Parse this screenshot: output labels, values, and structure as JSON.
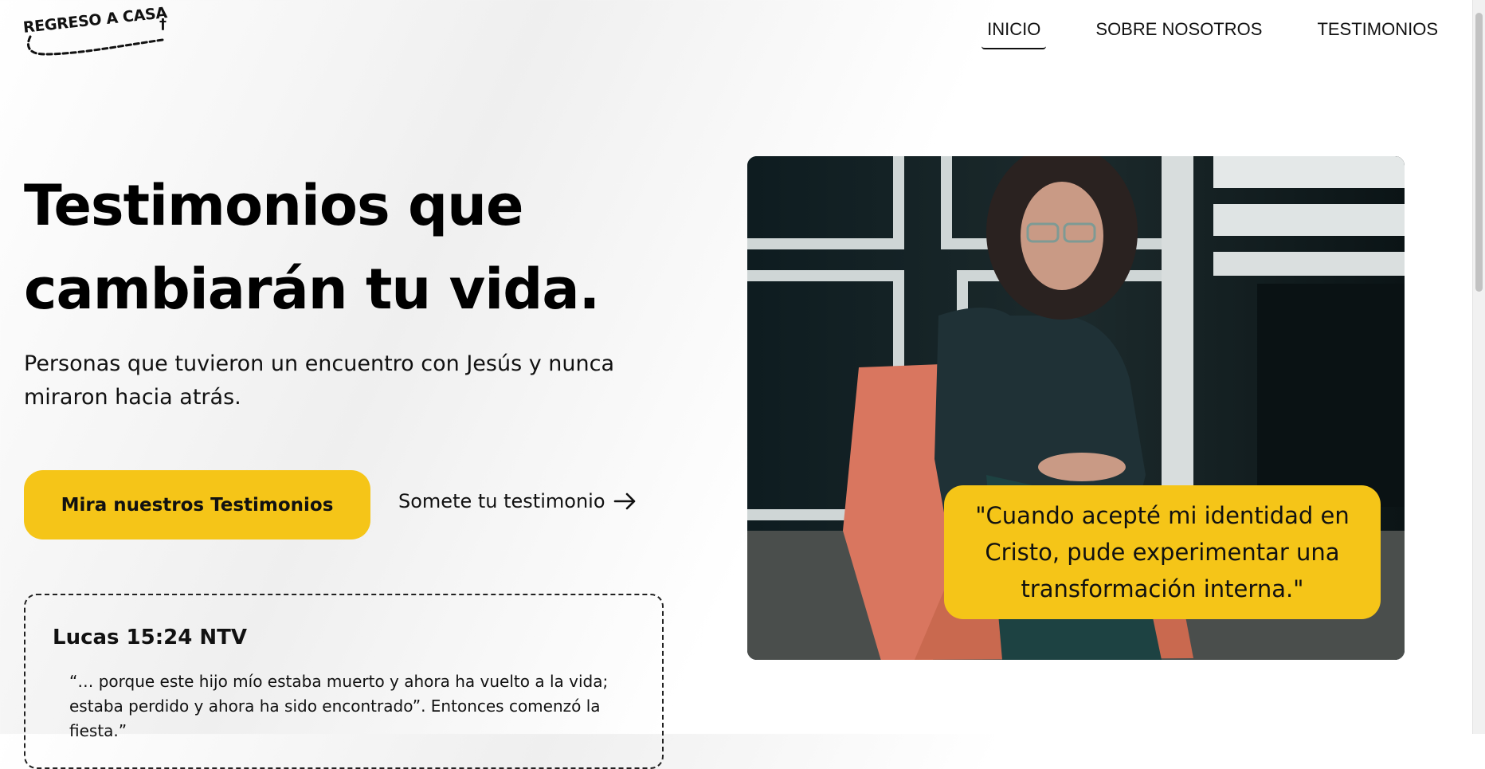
{
  "header": {
    "logo_text": "REGRESO A CASA",
    "nav": [
      {
        "label": "INICIO",
        "active": true
      },
      {
        "label": "SOBRE NOSOTROS",
        "active": false
      },
      {
        "label": "TESTIMONIOS",
        "active": false
      }
    ]
  },
  "hero": {
    "title": "Testimonios que cambiarán tu vida.",
    "subtitle": "Personas que tuvieron un encuentro con Jesús y nunca miraron hacia atrás.",
    "cta_label": "Mira nuestros Testimonios",
    "submit_label": "Somete tu testimonio"
  },
  "verse": {
    "reference": "Lucas 15:24 NTV",
    "text": "“… porque este hijo mío estaba muerto y ahora ha vuelto a la vida; estaba perdido y ahora ha sido encontrado”. Entonces comenzó la fiesta.”"
  },
  "featured": {
    "quote": "\"Cuando acepté mi identidad en Cristo, pude experimentar una transformación interna.\""
  },
  "colors": {
    "accent": "#f5c518",
    "text": "#111111"
  },
  "icons": [
    "arrow-right-icon",
    "cross-icon"
  ]
}
